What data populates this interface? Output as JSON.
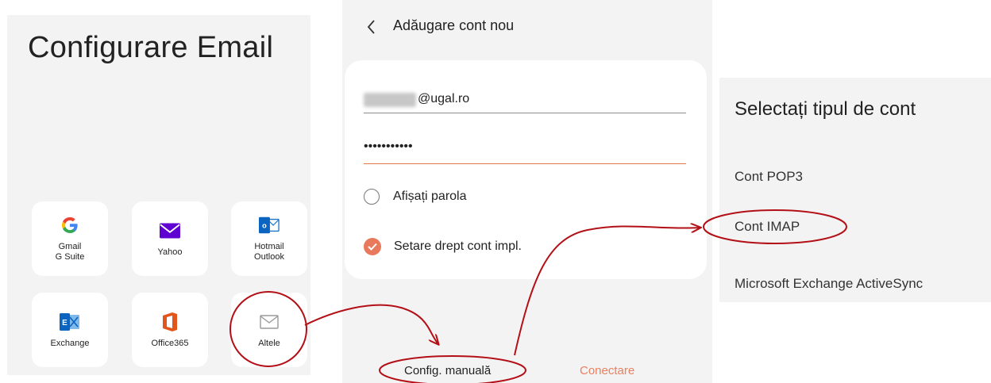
{
  "panel1": {
    "title": "Configurare Email",
    "tiles": [
      {
        "label": "Gmail\nG Suite",
        "icon": "google-icon"
      },
      {
        "label": "Yahoo",
        "icon": "yahoo-mail-icon"
      },
      {
        "label": "Hotmail\nOutlook",
        "icon": "outlook-icon"
      },
      {
        "label": "Exchange",
        "icon": "exchange-icon"
      },
      {
        "label": "Office365",
        "icon": "office365-icon"
      },
      {
        "label": "Altele",
        "icon": "envelope-icon"
      }
    ]
  },
  "panel2": {
    "title": "Adăugare cont nou",
    "email_value": "@ugal.ro",
    "password_value": "•••••••••••",
    "show_password_label": "Afișați parola",
    "default_account_label": "Setare drept cont impl.",
    "manual_config_label": "Config. manuală",
    "connect_label": "Conectare"
  },
  "panel3": {
    "title": "Selectați tipul de cont",
    "options": [
      {
        "label": "Cont POP3"
      },
      {
        "label": "Cont IMAP"
      },
      {
        "label": "Microsoft Exchange ActiveSync"
      }
    ]
  },
  "colors": {
    "accent": "#e9805f",
    "annotation": "#b30f16",
    "panel_bg": "#f3f3f3"
  }
}
